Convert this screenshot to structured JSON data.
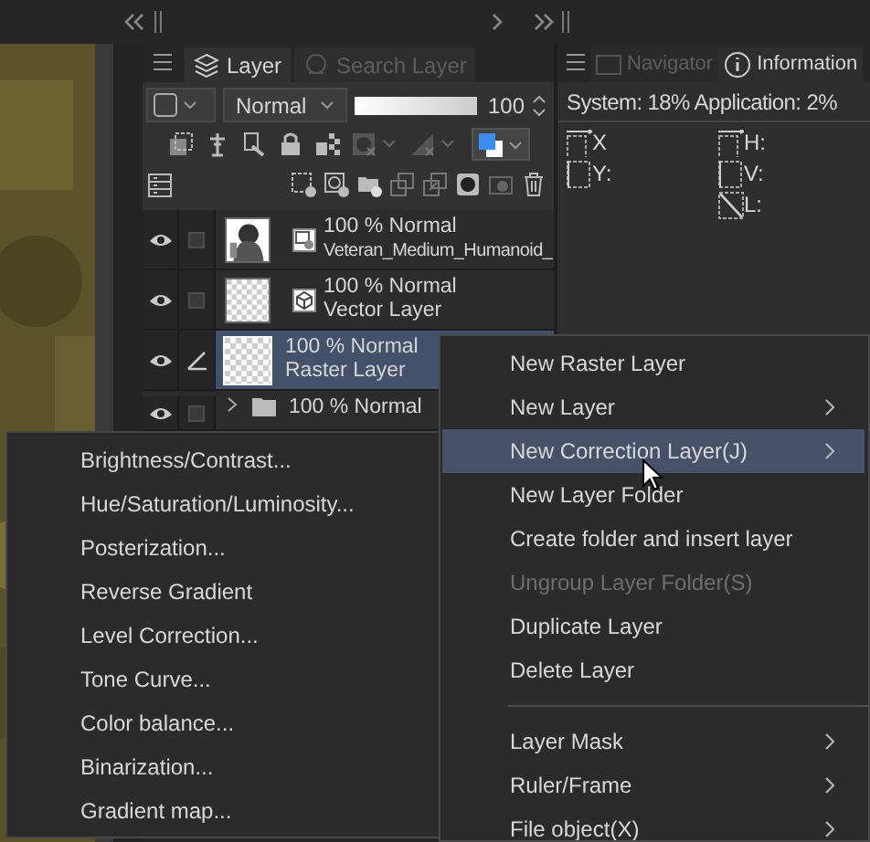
{
  "layer_panel": {
    "tabs": [
      {
        "label": "Layer",
        "selected": true
      },
      {
        "label": "Search Layer",
        "selected": false
      }
    ],
    "blend_mode": "Normal",
    "opacity": {
      "level": 1,
      "value": "100"
    },
    "layers": [
      {
        "kind": "file",
        "mode": "100 % Normal",
        "name": "Veteran_Medium_Humanoid_",
        "selected": false
      },
      {
        "kind": "vector",
        "mode": "100 % Normal",
        "name": "Vector Layer",
        "selected": false
      },
      {
        "kind": "raster",
        "mode": "100 % Normal",
        "name": "Raster Layer",
        "selected": true
      },
      {
        "kind": "folder",
        "mode": "100 % Normal",
        "selected": false
      }
    ]
  },
  "info_panel": {
    "tabs": [
      {
        "label": "Navigator",
        "selected": false
      },
      {
        "label": "Information",
        "selected": true
      }
    ],
    "status": "System: 18% Application: 2%",
    "fields": [
      {
        "label": "X"
      },
      {
        "label": "Y:"
      },
      {
        "label": "H:"
      },
      {
        "label": "V:"
      },
      {
        "label": "L:"
      }
    ]
  },
  "context_menu": {
    "items": [
      {
        "kind": "item",
        "label": "New Raster Layer",
        "submenu": false,
        "disabled": false,
        "selected": false
      },
      {
        "kind": "item",
        "label": "New Layer",
        "submenu": true,
        "disabled": false,
        "selected": false
      },
      {
        "kind": "item",
        "label": "New Correction Layer(J)",
        "submenu": true,
        "disabled": false,
        "selected": true
      },
      {
        "kind": "item",
        "label": "New Layer Folder",
        "submenu": false,
        "disabled": false,
        "selected": false
      },
      {
        "kind": "item",
        "label": "Create folder and insert layer",
        "submenu": false,
        "disabled": false,
        "selected": false
      },
      {
        "kind": "item",
        "label": "Ungroup Layer Folder(S)",
        "submenu": false,
        "disabled": true,
        "selected": false
      },
      {
        "kind": "item",
        "label": "Duplicate Layer",
        "submenu": false,
        "disabled": false,
        "selected": false
      },
      {
        "kind": "item",
        "label": "Delete Layer",
        "submenu": false,
        "disabled": false,
        "selected": false
      },
      {
        "kind": "separator"
      },
      {
        "kind": "item",
        "label": "Layer Mask",
        "submenu": true,
        "disabled": false,
        "selected": false
      },
      {
        "kind": "item",
        "label": "Ruler/Frame",
        "submenu": true,
        "disabled": false,
        "selected": false
      },
      {
        "kind": "item",
        "label": "File object(X)",
        "submenu": true,
        "disabled": false,
        "selected": false
      }
    ]
  },
  "submenu": {
    "items": [
      {
        "label": "Brightness/Contrast..."
      },
      {
        "label": "Hue/Saturation/Luminosity..."
      },
      {
        "label": "Posterization..."
      },
      {
        "label": "Reverse Gradient"
      },
      {
        "label": "Level Correction..."
      },
      {
        "label": "Tone Curve..."
      },
      {
        "label": "Color balance..."
      },
      {
        "label": "Binarization..."
      },
      {
        "label": "Gradient map..."
      }
    ]
  }
}
